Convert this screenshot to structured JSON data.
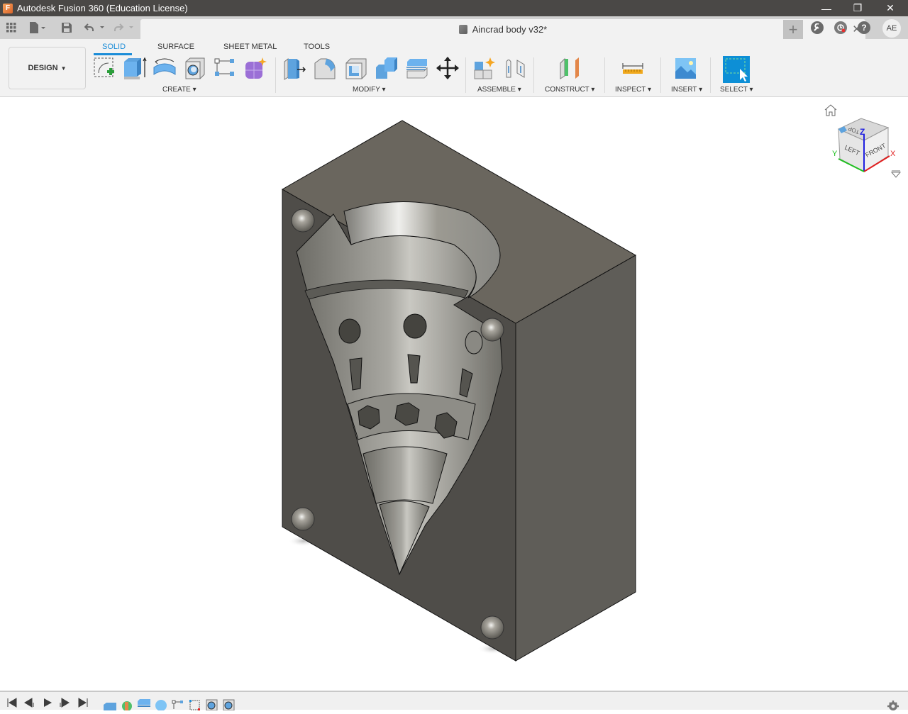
{
  "window": {
    "title": "Autodesk Fusion 360 (Education License)",
    "logo_letter": "F",
    "controls": {
      "minimize": "—",
      "restore": "❐",
      "close": "✕"
    }
  },
  "quickbar": {
    "apps_icon": "grid-icon",
    "file_icon": "file-icon",
    "save_icon": "save-icon",
    "undo_icon": "undo-icon",
    "redo_icon": "redo-icon"
  },
  "document_tab": {
    "title": "Aincrad body v32*",
    "close": "✕"
  },
  "header_right": {
    "new_tab": "+",
    "extensions": "extensions-icon",
    "job_status": "job-status-icon",
    "help": "?",
    "user_initials": "AE"
  },
  "toolbar": {
    "workspace": "DESIGN",
    "tabs": [
      {
        "label": "SOLID",
        "active": true
      },
      {
        "label": "SURFACE",
        "active": false
      },
      {
        "label": "SHEET METAL",
        "active": false
      },
      {
        "label": "TOOLS",
        "active": false
      }
    ],
    "groups": [
      {
        "label": "CREATE",
        "tools": [
          "create-sketch",
          "extrude",
          "revolve",
          "hole",
          "pattern",
          "create-form"
        ]
      },
      {
        "label": "MODIFY",
        "tools": [
          "press-pull",
          "fillet",
          "shell",
          "combine",
          "split-face",
          "move-copy"
        ]
      },
      {
        "label": "ASSEMBLE",
        "tools": [
          "new-component",
          "joint"
        ]
      },
      {
        "label": "CONSTRUCT",
        "tools": [
          "offset-plane"
        ]
      },
      {
        "label": "INSPECT",
        "tools": [
          "measure"
        ]
      },
      {
        "label": "INSERT",
        "tools": [
          "insert-image"
        ]
      },
      {
        "label": "SELECT",
        "tools": [
          "window-select"
        ]
      }
    ]
  },
  "viewcube": {
    "faces": {
      "top": "TOP",
      "left": "LEFT",
      "front": "FRONT"
    },
    "axes": {
      "x": "X",
      "y": "Y",
      "z": "Z"
    },
    "colors": {
      "x": "#e02020",
      "y": "#20c020",
      "z": "#2020e0"
    }
  },
  "model": {
    "body_color": "#57544f",
    "name": "Aincrad body"
  },
  "timeline": {
    "controls": [
      "first",
      "previous",
      "play",
      "next",
      "last"
    ],
    "features": [
      "extrude",
      "create-form",
      "split-body",
      "sphere",
      "pattern",
      "sketch",
      "hole",
      "hole"
    ],
    "settings_icon": "gear-icon"
  }
}
